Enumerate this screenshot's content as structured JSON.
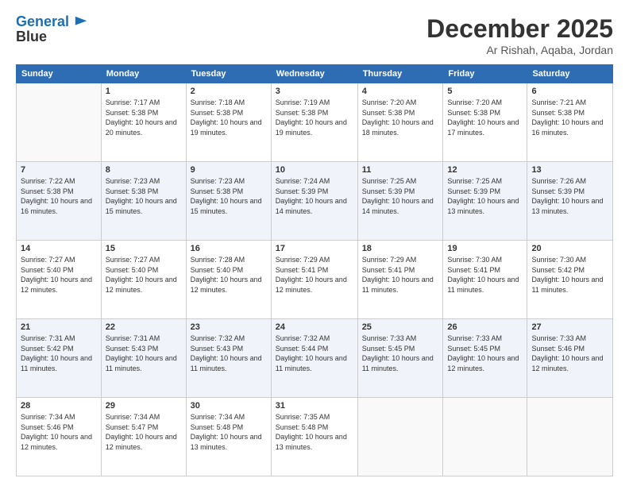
{
  "header": {
    "logo_line1": "General",
    "logo_line2": "Blue",
    "month": "December 2025",
    "location": "Ar Rishah, Aqaba, Jordan"
  },
  "weekdays": [
    "Sunday",
    "Monday",
    "Tuesday",
    "Wednesday",
    "Thursday",
    "Friday",
    "Saturday"
  ],
  "weeks": [
    [
      {
        "day": "",
        "sunrise": "",
        "sunset": "",
        "daylight": ""
      },
      {
        "day": "1",
        "sunrise": "Sunrise: 7:17 AM",
        "sunset": "Sunset: 5:38 PM",
        "daylight": "Daylight: 10 hours and 20 minutes."
      },
      {
        "day": "2",
        "sunrise": "Sunrise: 7:18 AM",
        "sunset": "Sunset: 5:38 PM",
        "daylight": "Daylight: 10 hours and 19 minutes."
      },
      {
        "day": "3",
        "sunrise": "Sunrise: 7:19 AM",
        "sunset": "Sunset: 5:38 PM",
        "daylight": "Daylight: 10 hours and 19 minutes."
      },
      {
        "day": "4",
        "sunrise": "Sunrise: 7:20 AM",
        "sunset": "Sunset: 5:38 PM",
        "daylight": "Daylight: 10 hours and 18 minutes."
      },
      {
        "day": "5",
        "sunrise": "Sunrise: 7:20 AM",
        "sunset": "Sunset: 5:38 PM",
        "daylight": "Daylight: 10 hours and 17 minutes."
      },
      {
        "day": "6",
        "sunrise": "Sunrise: 7:21 AM",
        "sunset": "Sunset: 5:38 PM",
        "daylight": "Daylight: 10 hours and 16 minutes."
      }
    ],
    [
      {
        "day": "7",
        "sunrise": "Sunrise: 7:22 AM",
        "sunset": "Sunset: 5:38 PM",
        "daylight": "Daylight: 10 hours and 16 minutes."
      },
      {
        "day": "8",
        "sunrise": "Sunrise: 7:23 AM",
        "sunset": "Sunset: 5:38 PM",
        "daylight": "Daylight: 10 hours and 15 minutes."
      },
      {
        "day": "9",
        "sunrise": "Sunrise: 7:23 AM",
        "sunset": "Sunset: 5:38 PM",
        "daylight": "Daylight: 10 hours and 15 minutes."
      },
      {
        "day": "10",
        "sunrise": "Sunrise: 7:24 AM",
        "sunset": "Sunset: 5:39 PM",
        "daylight": "Daylight: 10 hours and 14 minutes."
      },
      {
        "day": "11",
        "sunrise": "Sunrise: 7:25 AM",
        "sunset": "Sunset: 5:39 PM",
        "daylight": "Daylight: 10 hours and 14 minutes."
      },
      {
        "day": "12",
        "sunrise": "Sunrise: 7:25 AM",
        "sunset": "Sunset: 5:39 PM",
        "daylight": "Daylight: 10 hours and 13 minutes."
      },
      {
        "day": "13",
        "sunrise": "Sunrise: 7:26 AM",
        "sunset": "Sunset: 5:39 PM",
        "daylight": "Daylight: 10 hours and 13 minutes."
      }
    ],
    [
      {
        "day": "14",
        "sunrise": "Sunrise: 7:27 AM",
        "sunset": "Sunset: 5:40 PM",
        "daylight": "Daylight: 10 hours and 12 minutes."
      },
      {
        "day": "15",
        "sunrise": "Sunrise: 7:27 AM",
        "sunset": "Sunset: 5:40 PM",
        "daylight": "Daylight: 10 hours and 12 minutes."
      },
      {
        "day": "16",
        "sunrise": "Sunrise: 7:28 AM",
        "sunset": "Sunset: 5:40 PM",
        "daylight": "Daylight: 10 hours and 12 minutes."
      },
      {
        "day": "17",
        "sunrise": "Sunrise: 7:29 AM",
        "sunset": "Sunset: 5:41 PM",
        "daylight": "Daylight: 10 hours and 12 minutes."
      },
      {
        "day": "18",
        "sunrise": "Sunrise: 7:29 AM",
        "sunset": "Sunset: 5:41 PM",
        "daylight": "Daylight: 10 hours and 11 minutes."
      },
      {
        "day": "19",
        "sunrise": "Sunrise: 7:30 AM",
        "sunset": "Sunset: 5:41 PM",
        "daylight": "Daylight: 10 hours and 11 minutes."
      },
      {
        "day": "20",
        "sunrise": "Sunrise: 7:30 AM",
        "sunset": "Sunset: 5:42 PM",
        "daylight": "Daylight: 10 hours and 11 minutes."
      }
    ],
    [
      {
        "day": "21",
        "sunrise": "Sunrise: 7:31 AM",
        "sunset": "Sunset: 5:42 PM",
        "daylight": "Daylight: 10 hours and 11 minutes."
      },
      {
        "day": "22",
        "sunrise": "Sunrise: 7:31 AM",
        "sunset": "Sunset: 5:43 PM",
        "daylight": "Daylight: 10 hours and 11 minutes."
      },
      {
        "day": "23",
        "sunrise": "Sunrise: 7:32 AM",
        "sunset": "Sunset: 5:43 PM",
        "daylight": "Daylight: 10 hours and 11 minutes."
      },
      {
        "day": "24",
        "sunrise": "Sunrise: 7:32 AM",
        "sunset": "Sunset: 5:44 PM",
        "daylight": "Daylight: 10 hours and 11 minutes."
      },
      {
        "day": "25",
        "sunrise": "Sunrise: 7:33 AM",
        "sunset": "Sunset: 5:45 PM",
        "daylight": "Daylight: 10 hours and 11 minutes."
      },
      {
        "day": "26",
        "sunrise": "Sunrise: 7:33 AM",
        "sunset": "Sunset: 5:45 PM",
        "daylight": "Daylight: 10 hours and 12 minutes."
      },
      {
        "day": "27",
        "sunrise": "Sunrise: 7:33 AM",
        "sunset": "Sunset: 5:46 PM",
        "daylight": "Daylight: 10 hours and 12 minutes."
      }
    ],
    [
      {
        "day": "28",
        "sunrise": "Sunrise: 7:34 AM",
        "sunset": "Sunset: 5:46 PM",
        "daylight": "Daylight: 10 hours and 12 minutes."
      },
      {
        "day": "29",
        "sunrise": "Sunrise: 7:34 AM",
        "sunset": "Sunset: 5:47 PM",
        "daylight": "Daylight: 10 hours and 12 minutes."
      },
      {
        "day": "30",
        "sunrise": "Sunrise: 7:34 AM",
        "sunset": "Sunset: 5:48 PM",
        "daylight": "Daylight: 10 hours and 13 minutes."
      },
      {
        "day": "31",
        "sunrise": "Sunrise: 7:35 AM",
        "sunset": "Sunset: 5:48 PM",
        "daylight": "Daylight: 10 hours and 13 minutes."
      },
      {
        "day": "",
        "sunrise": "",
        "sunset": "",
        "daylight": ""
      },
      {
        "day": "",
        "sunrise": "",
        "sunset": "",
        "daylight": ""
      },
      {
        "day": "",
        "sunrise": "",
        "sunset": "",
        "daylight": ""
      }
    ]
  ]
}
